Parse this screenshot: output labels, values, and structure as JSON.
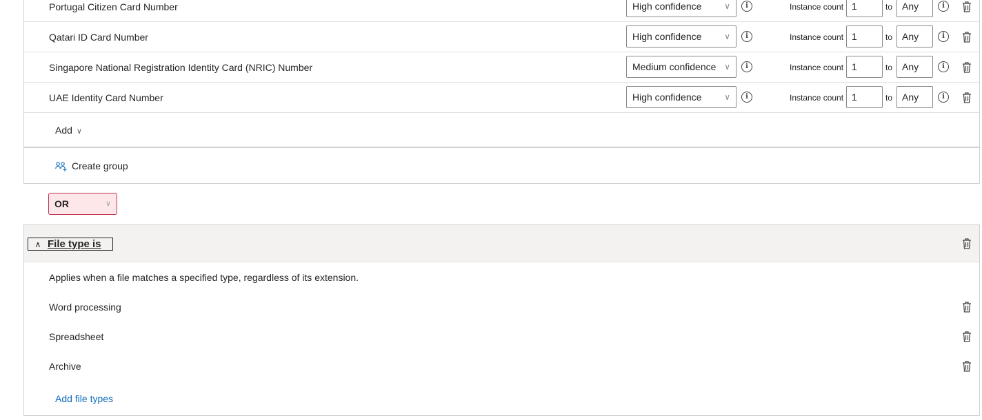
{
  "sit_rows": [
    {
      "name": "Portugal Citizen Card Number",
      "confidence": "High confidence",
      "instance_label": "Instance count",
      "min": "1",
      "to_label": "to",
      "max": "Any"
    },
    {
      "name": "Qatari ID Card Number",
      "confidence": "High confidence",
      "instance_label": "Instance count",
      "min": "1",
      "to_label": "to",
      "max": "Any"
    },
    {
      "name": "Singapore National Registration Identity Card (NRIC) Number",
      "confidence": "Medium confidence",
      "instance_label": "Instance count",
      "min": "1",
      "to_label": "to",
      "max": "Any"
    },
    {
      "name": "UAE Identity Card Number",
      "confidence": "High confidence",
      "instance_label": "Instance count",
      "min": "1",
      "to_label": "to",
      "max": "Any"
    }
  ],
  "icons": {
    "chevron": "chevron-down-icon",
    "info": "info-icon",
    "delete": "trash-icon",
    "group": "create-group-icon",
    "collapse": "chevron-up-icon"
  },
  "add_label": "Add",
  "create_group_label": "Create group",
  "operator": "OR",
  "file_type": {
    "title": "File type is",
    "description": "Applies when a file matches a specified type, regardless of its extension.",
    "items": [
      "Word processing",
      "Spreadsheet",
      "Archive"
    ],
    "add_label": "Add file types"
  },
  "colors": {
    "link": "#0f6cbd",
    "operator_bg": "#fde7e9",
    "operator_border": "#c4314b",
    "header_bg": "#f3f2f1"
  }
}
